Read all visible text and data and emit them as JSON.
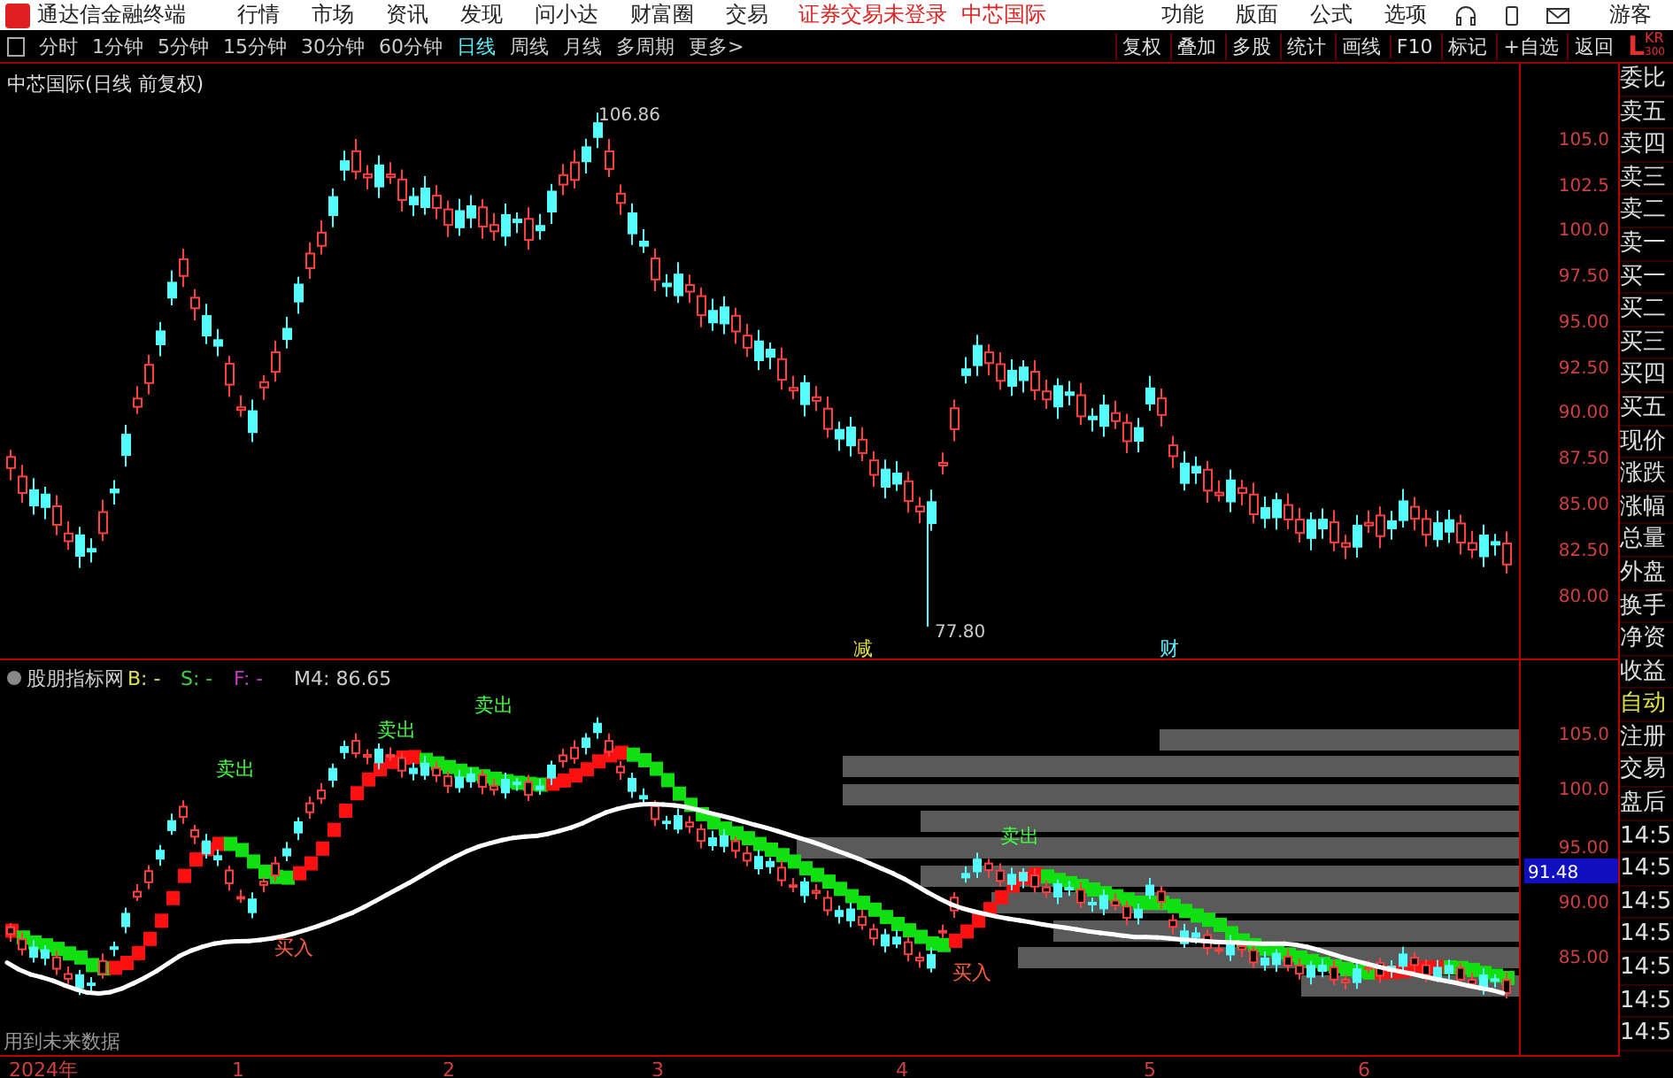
{
  "app": {
    "title": "通达信金融终端",
    "menus": [
      "行情",
      "市场",
      "资讯",
      "发现",
      "问小达",
      "财富圈",
      "交易"
    ],
    "login_notice": "证券交易未登录",
    "stock_name": "中芯国际",
    "right_menus": [
      "功能",
      "版面",
      "公式",
      "选项"
    ],
    "user": "游客"
  },
  "periods": [
    {
      "label": "分时",
      "selected": false
    },
    {
      "label": "1分钟",
      "selected": false
    },
    {
      "label": "5分钟",
      "selected": false
    },
    {
      "label": "15分钟",
      "selected": false
    },
    {
      "label": "30分钟",
      "selected": false
    },
    {
      "label": "60分钟",
      "selected": false
    },
    {
      "label": "日线",
      "selected": true
    },
    {
      "label": "周线",
      "selected": false
    },
    {
      "label": "月线",
      "selected": false
    },
    {
      "label": "多周期",
      "selected": false
    },
    {
      "label": "更多>",
      "selected": false
    }
  ],
  "tools": [
    "复权",
    "叠加",
    "多股",
    "统计",
    "画线",
    "F10",
    "标记",
    "+自选",
    "返回"
  ],
  "level_badge": {
    "letter": "L",
    "code": "KR",
    "sub": "300"
  },
  "main_chart": {
    "title": "中芯国际(日线 前复权)",
    "high_label": "106.86",
    "low_label": "77.80",
    "event_marks": [
      "减",
      "财"
    ],
    "y_labels": [
      "105.0",
      "102.5",
      "100.0",
      "97.50",
      "95.00",
      "92.50",
      "90.00",
      "87.50",
      "85.00",
      "82.50",
      "80.00"
    ]
  },
  "indicator": {
    "name": "股朋指标网",
    "legend": [
      {
        "label": "B: -",
        "color": "#e0e060"
      },
      {
        "label": "S: -",
        "color": "#40d040"
      },
      {
        "label": "F: -",
        "color": "#c040c0"
      }
    ],
    "m4": "M4: 86.65",
    "signals": [
      {
        "label": "卖出",
        "kind": "sell"
      },
      {
        "label": "卖出",
        "kind": "sell"
      },
      {
        "label": "卖出",
        "kind": "sell"
      },
      {
        "label": "卖出",
        "kind": "sell"
      },
      {
        "label": "买入",
        "kind": "buy"
      },
      {
        "label": "买入",
        "kind": "buy"
      }
    ],
    "note": "用到未来数据",
    "y_labels": [
      "105.0",
      "100.0",
      "95.00",
      "90.00",
      "85.00"
    ],
    "current_value": "91.48"
  },
  "x_labels": [
    "2024年",
    "1",
    "2",
    "3",
    "4",
    "5",
    "6"
  ],
  "side_panel": [
    {
      "label": "委比",
      "highlighted": false
    },
    {
      "label": "卖五",
      "highlighted": false
    },
    {
      "label": "卖四",
      "highlighted": false
    },
    {
      "label": "卖三",
      "highlighted": false
    },
    {
      "label": "卖二",
      "highlighted": false
    },
    {
      "label": "卖一",
      "highlighted": false
    },
    {
      "label": "买一",
      "highlighted": false
    },
    {
      "label": "买二",
      "highlighted": false
    },
    {
      "label": "买三",
      "highlighted": false
    },
    {
      "label": "买四",
      "highlighted": false
    },
    {
      "label": "买五",
      "highlighted": false
    },
    {
      "label": "现价",
      "highlighted": false
    },
    {
      "label": "涨跌",
      "highlighted": false
    },
    {
      "label": "涨幅",
      "highlighted": false
    },
    {
      "label": "总量",
      "highlighted": false
    },
    {
      "label": "外盘",
      "highlighted": false
    },
    {
      "label": "换手",
      "highlighted": false
    },
    {
      "label": "净资",
      "highlighted": false
    },
    {
      "label": "收益",
      "highlighted": false
    },
    {
      "label": "自动",
      "highlighted": true
    },
    {
      "label": "注册",
      "highlighted": false
    },
    {
      "label": "交易",
      "highlighted": false
    },
    {
      "label": "盘后",
      "highlighted": false
    },
    {
      "label": "14:5",
      "highlighted": false
    },
    {
      "label": "14:5",
      "highlighted": false
    },
    {
      "label": "14:5",
      "highlighted": false
    },
    {
      "label": "14:5",
      "highlighted": false
    },
    {
      "label": "14:5",
      "highlighted": false
    },
    {
      "label": "14:5",
      "highlighted": false
    },
    {
      "label": "14:5",
      "highlighted": false
    }
  ]
}
